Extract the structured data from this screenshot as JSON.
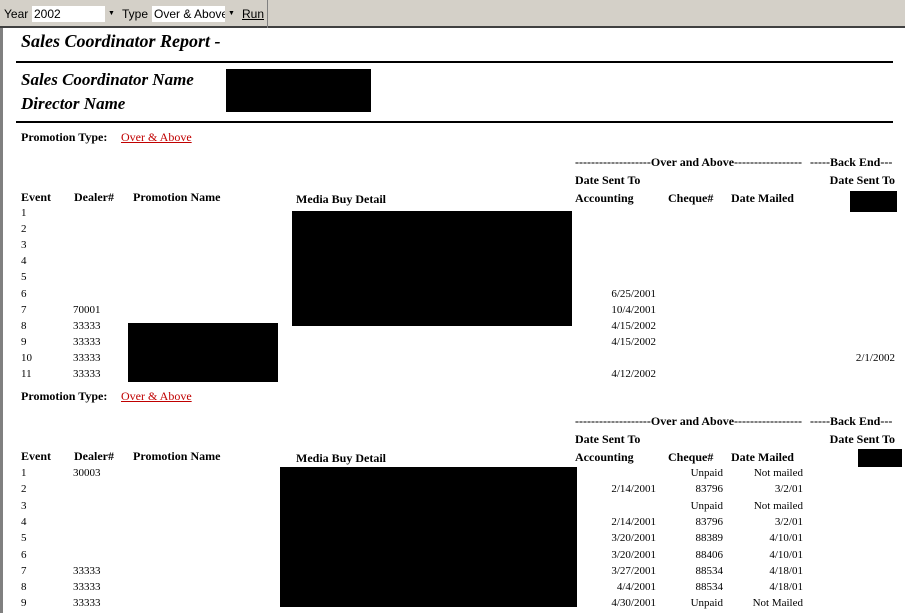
{
  "toolbar": {
    "year_label": "Year",
    "year_value": "2002",
    "type_label": "Type",
    "type_value": "Over & Above",
    "run_label": "Run"
  },
  "report": {
    "title": "Sales Coordinator Report  -",
    "coordinator_label": "Sales Coordinator Name",
    "director_label": "Director Name"
  },
  "columns": {
    "event": "Event",
    "dealer": "Dealer#",
    "promotion": "Promotion Name",
    "media": "Media Buy Detail",
    "group_oa": "-------------------Over and Above-----------------",
    "group_be": "-----Back End---",
    "date_sent_to": "Date Sent To",
    "accounting": "Accounting",
    "cheque": "Cheque#",
    "date_mailed": "Date Mailed",
    "be_date_sent_to": "Date Sent To"
  },
  "sections": [
    {
      "promotion_type_label": "Promotion Type:",
      "promotion_type": "Over & Above",
      "rows": [
        {
          "event": "1",
          "dealer": "",
          "accounting": "",
          "cheque": "",
          "mailed": "",
          "backend": ""
        },
        {
          "event": "2",
          "dealer": "",
          "accounting": "",
          "cheque": "",
          "mailed": "",
          "backend": ""
        },
        {
          "event": "3",
          "dealer": "",
          "accounting": "",
          "cheque": "",
          "mailed": "",
          "backend": ""
        },
        {
          "event": "4",
          "dealer": "",
          "accounting": "",
          "cheque": "",
          "mailed": "",
          "backend": ""
        },
        {
          "event": "5",
          "dealer": "",
          "accounting": "",
          "cheque": "",
          "mailed": "",
          "backend": ""
        },
        {
          "event": "6",
          "dealer": "",
          "accounting": "6/25/2001",
          "cheque": "",
          "mailed": "",
          "backend": ""
        },
        {
          "event": "7",
          "dealer": "70001",
          "accounting": "10/4/2001",
          "cheque": "",
          "mailed": "",
          "backend": ""
        },
        {
          "event": "8",
          "dealer": "33333",
          "accounting": "4/15/2002",
          "cheque": "",
          "mailed": "",
          "backend": ""
        },
        {
          "event": "9",
          "dealer": "33333",
          "accounting": "4/15/2002",
          "cheque": "",
          "mailed": "",
          "backend": ""
        },
        {
          "event": "10",
          "dealer": "33333",
          "accounting": "",
          "cheque": "",
          "mailed": "",
          "backend": "2/1/2002"
        },
        {
          "event": "11",
          "dealer": "33333",
          "accounting": "4/12/2002",
          "cheque": "",
          "mailed": "",
          "backend": ""
        }
      ]
    },
    {
      "promotion_type_label": "Promotion Type:",
      "promotion_type": "Over & Above",
      "rows": [
        {
          "event": "1",
          "dealer": "30003",
          "accounting": "",
          "cheque": "Unpaid",
          "mailed": "Not mailed",
          "backend": ""
        },
        {
          "event": "2",
          "dealer": "",
          "accounting": "2/14/2001",
          "cheque": "83796",
          "mailed": "3/2/01",
          "backend": ""
        },
        {
          "event": "3",
          "dealer": "",
          "accounting": "",
          "cheque": "Unpaid",
          "mailed": "Not mailed",
          "backend": ""
        },
        {
          "event": "4",
          "dealer": "",
          "accounting": "2/14/2001",
          "cheque": "83796",
          "mailed": "3/2/01",
          "backend": ""
        },
        {
          "event": "5",
          "dealer": "",
          "accounting": "3/20/2001",
          "cheque": "88389",
          "mailed": "4/10/01",
          "backend": ""
        },
        {
          "event": "6",
          "dealer": "",
          "accounting": "3/20/2001",
          "cheque": "88406",
          "mailed": "4/10/01",
          "backend": ""
        },
        {
          "event": "7",
          "dealer": "33333",
          "accounting": "3/27/2001",
          "cheque": "88534",
          "mailed": "4/18/01",
          "backend": ""
        },
        {
          "event": "8",
          "dealer": "33333",
          "accounting": "4/4/2001",
          "cheque": "88534",
          "mailed": "4/18/01",
          "backend": ""
        },
        {
          "event": "9",
          "dealer": "33333",
          "accounting": "4/30/2001",
          "cheque": "Unpaid",
          "mailed": "Not Mailed",
          "backend": ""
        }
      ]
    }
  ]
}
